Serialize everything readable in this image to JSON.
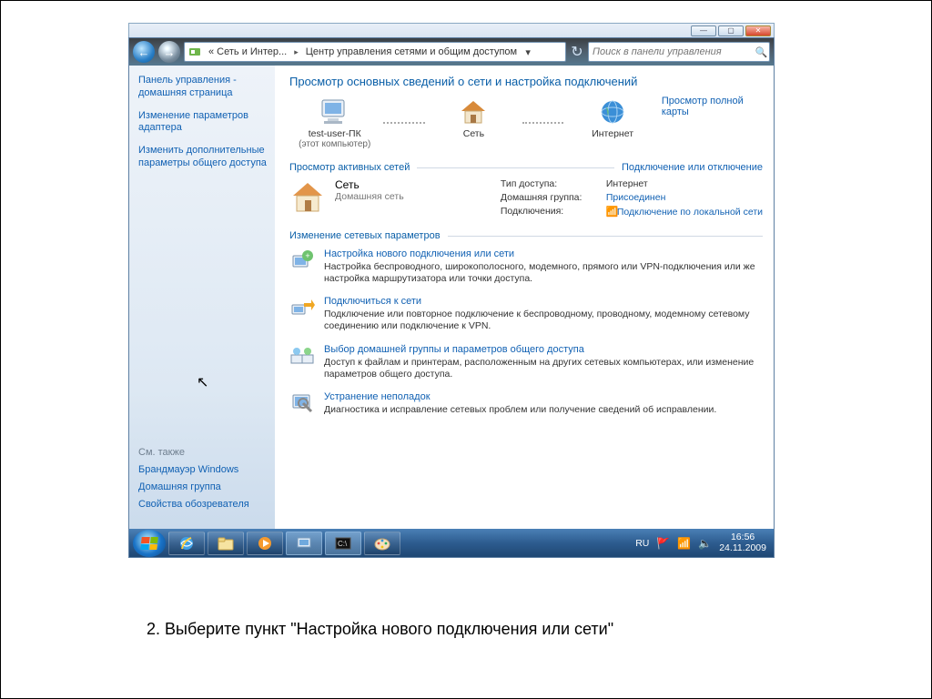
{
  "window_buttons": {
    "min": "—",
    "max": "▢",
    "close": "✕"
  },
  "breadcrumb": {
    "icon": "network-panel-icon",
    "item1": "« Сеть и Интер...",
    "item2": "Центр управления сетями и общим доступом"
  },
  "search": {
    "placeholder": "Поиск в панели управления"
  },
  "sidebar": {
    "items": [
      "Панель управления - домашняя страница",
      "Изменение параметров адаптера",
      "Изменить дополнительные параметры общего доступа"
    ],
    "also_header": "См. также",
    "also": [
      "Брандмауэр Windows",
      "Домашняя группа",
      "Свойства обозревателя"
    ]
  },
  "main": {
    "title": "Просмотр основных сведений о сети и настройка подключений",
    "map": {
      "node1_label": "test-user-ПК",
      "node1_sub": "(этот компьютер)",
      "node2_label": "Сеть",
      "node3_label": "Интернет",
      "full_map_link": "Просмотр полной карты"
    },
    "active_header": "Просмотр активных сетей",
    "active_right_link": "Подключение или отключение",
    "net": {
      "name": "Сеть",
      "type": "Домашняя сеть"
    },
    "props": {
      "k1": "Тип доступа:",
      "v1": "Интернет",
      "k2": "Домашняя группа:",
      "v2": "Присоединен",
      "k3": "Подключения:",
      "v3": "Подключение по локальной сети"
    },
    "change_header": "Изменение сетевых параметров",
    "opts": [
      {
        "title": "Настройка нового подключения или сети",
        "desc": "Настройка беспроводного, широкополосного, модемного, прямого или VPN-подключения или же настройка маршрутизатора или точки доступа."
      },
      {
        "title": "Подключиться к сети",
        "desc": "Подключение или повторное подключение к беспроводному, проводному, модемному сетевому соединению или подключение к VPN."
      },
      {
        "title": "Выбор домашней группы и параметров общего доступа",
        "desc": "Доступ к файлам и принтерам, расположенным на других сетевых компьютерах, или изменение параметров общего доступа."
      },
      {
        "title": "Устранение неполадок",
        "desc": "Диагностика и исправление сетевых проблем или получение сведений об исправлении."
      }
    ]
  },
  "taskbar": {
    "lang": "RU",
    "time": "16:56",
    "date": "24.11.2009"
  },
  "instruction": "2. Выберите пункт \"Настройка нового подключения или сети\""
}
